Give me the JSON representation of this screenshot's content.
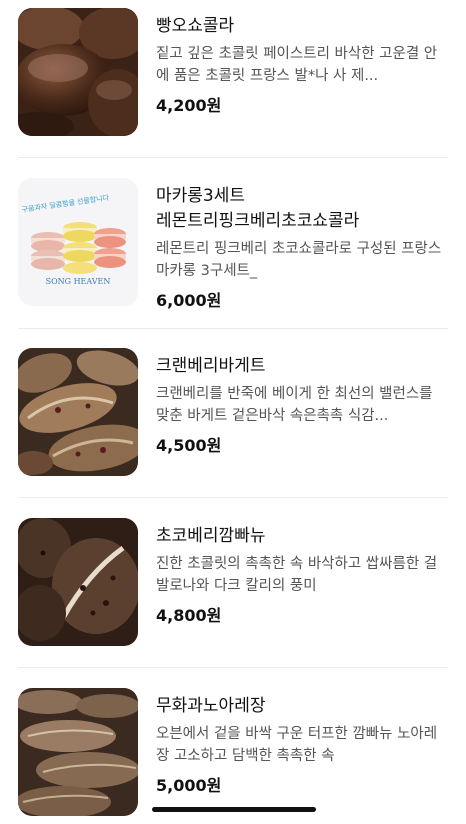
{
  "products": [
    {
      "name": "빵오쇼콜라",
      "description": "짙고 깊은 초콜릿 페이스트리 바삭한 고운결 안에 품은 초콜릿 프랑스 발*나 사 제...",
      "price": "4,200원",
      "image": "chocolate-pastry-photo"
    },
    {
      "name": "마카롱3세트 레몬트리핑크베리초코쇼콜라",
      "description": "레몬트리 핑크베리 초코쇼콜라로 구성된 프랑스마카롱 3구세트_",
      "price": "6,000원",
      "image": "macaron-set-photo",
      "image_caption": "구움과자 달콤함을 선물합니다",
      "image_brand": "SONG HEAVEN"
    },
    {
      "name": "크랜베리바게트",
      "description": "크랜베리를 반죽에 베이게 한 최선의 밸런스를 맞춘 바게트 겉은바삭 속은촉촉 식감...",
      "price": "4,500원",
      "image": "cranberry-baguette-photo"
    },
    {
      "name": "초코베리깜빠뉴",
      "description": "진한 초콜릿의 촉촉한 속 바삭하고 쌉싸름한 걸 발로나와 다크 칼리의 풍미",
      "price": "4,800원",
      "image": "choco-berry-campagne-photo"
    },
    {
      "name": "무화과노아레장",
      "description": "오븐에서 겉을 바싹 구운 터프한 깜빠뉴 노아레장 고소하고 담백한 촉촉한 속",
      "price": "5,000원",
      "image": "fig-noix-raisin-photo"
    }
  ]
}
